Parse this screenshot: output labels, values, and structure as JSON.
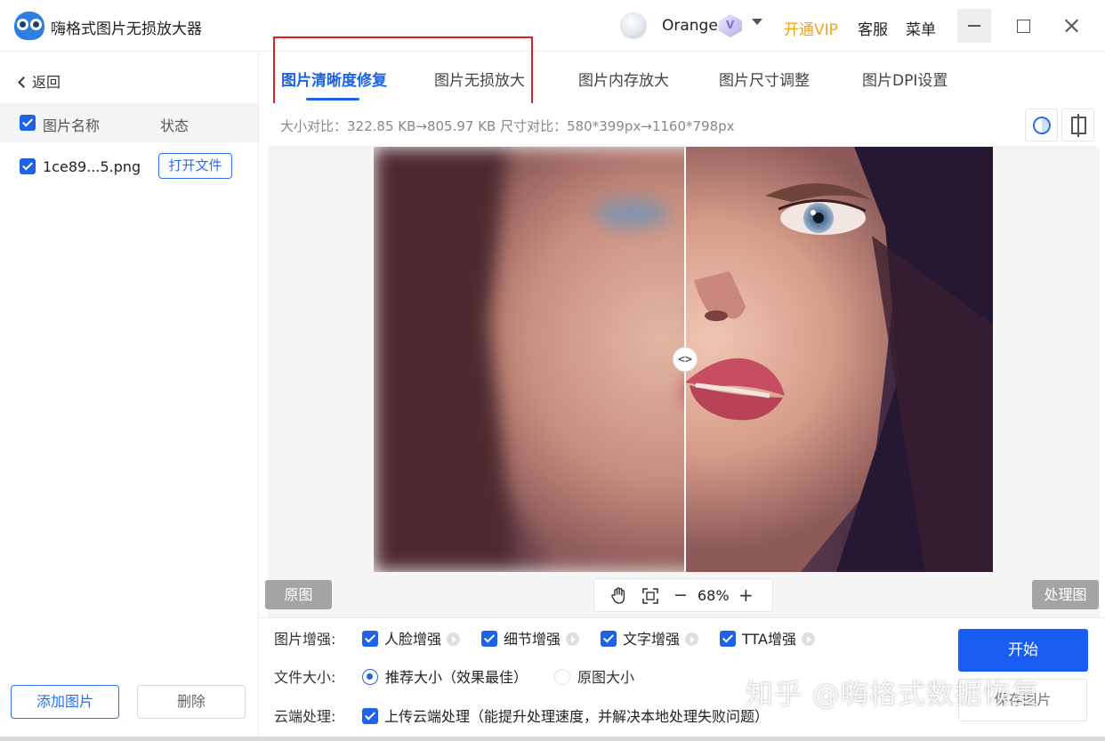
{
  "app": {
    "title": "嗨格式图片无损放大器"
  },
  "user": {
    "name": "Orange"
  },
  "header": {
    "vip": "开通VIP",
    "service": "客服",
    "menu": "菜单"
  },
  "sidebar": {
    "back": "返回",
    "header_name": "图片名称",
    "header_status": "状态",
    "files": [
      {
        "name": "1ce89...5.png",
        "action": "打开文件"
      }
    ],
    "add_button": "添加图片",
    "delete_button": "删除"
  },
  "tabs": [
    {
      "label": "图片清晰度修复"
    },
    {
      "label": "图片无损放大"
    },
    {
      "label": "图片内存放大"
    },
    {
      "label": "图片尺寸调整"
    },
    {
      "label": "图片DPI设置"
    }
  ],
  "info": {
    "size_compare": "大小对比：322.85 KB→805.97 KB   尺寸对比：580*399px→1160*798px"
  },
  "viewer": {
    "original_label": "原图",
    "processed_label": "处理图",
    "zoom": "68%",
    "zoom_minus": "−",
    "zoom_plus": "+"
  },
  "options": {
    "enhance_label": "图片增强:",
    "enhance_items": [
      "人脸增强",
      "细节增强",
      "文字增强",
      "TTA增强"
    ],
    "size_label": "文件大小:",
    "size_recommended": "推荐大小（效果最佳）",
    "size_original": "原图大小",
    "cloud_label": "云端处理:",
    "cloud_option": "上传云端处理（能提升处理速度，并解决本地处理失败问题）",
    "start_button": "开始",
    "save_button": "保存图片"
  },
  "watermark": "知乎 @嗨格式数据恢复",
  "colors": {
    "accent": "#1e63e6",
    "vip": "#f0a31a",
    "highlight_box": "#e02020"
  }
}
